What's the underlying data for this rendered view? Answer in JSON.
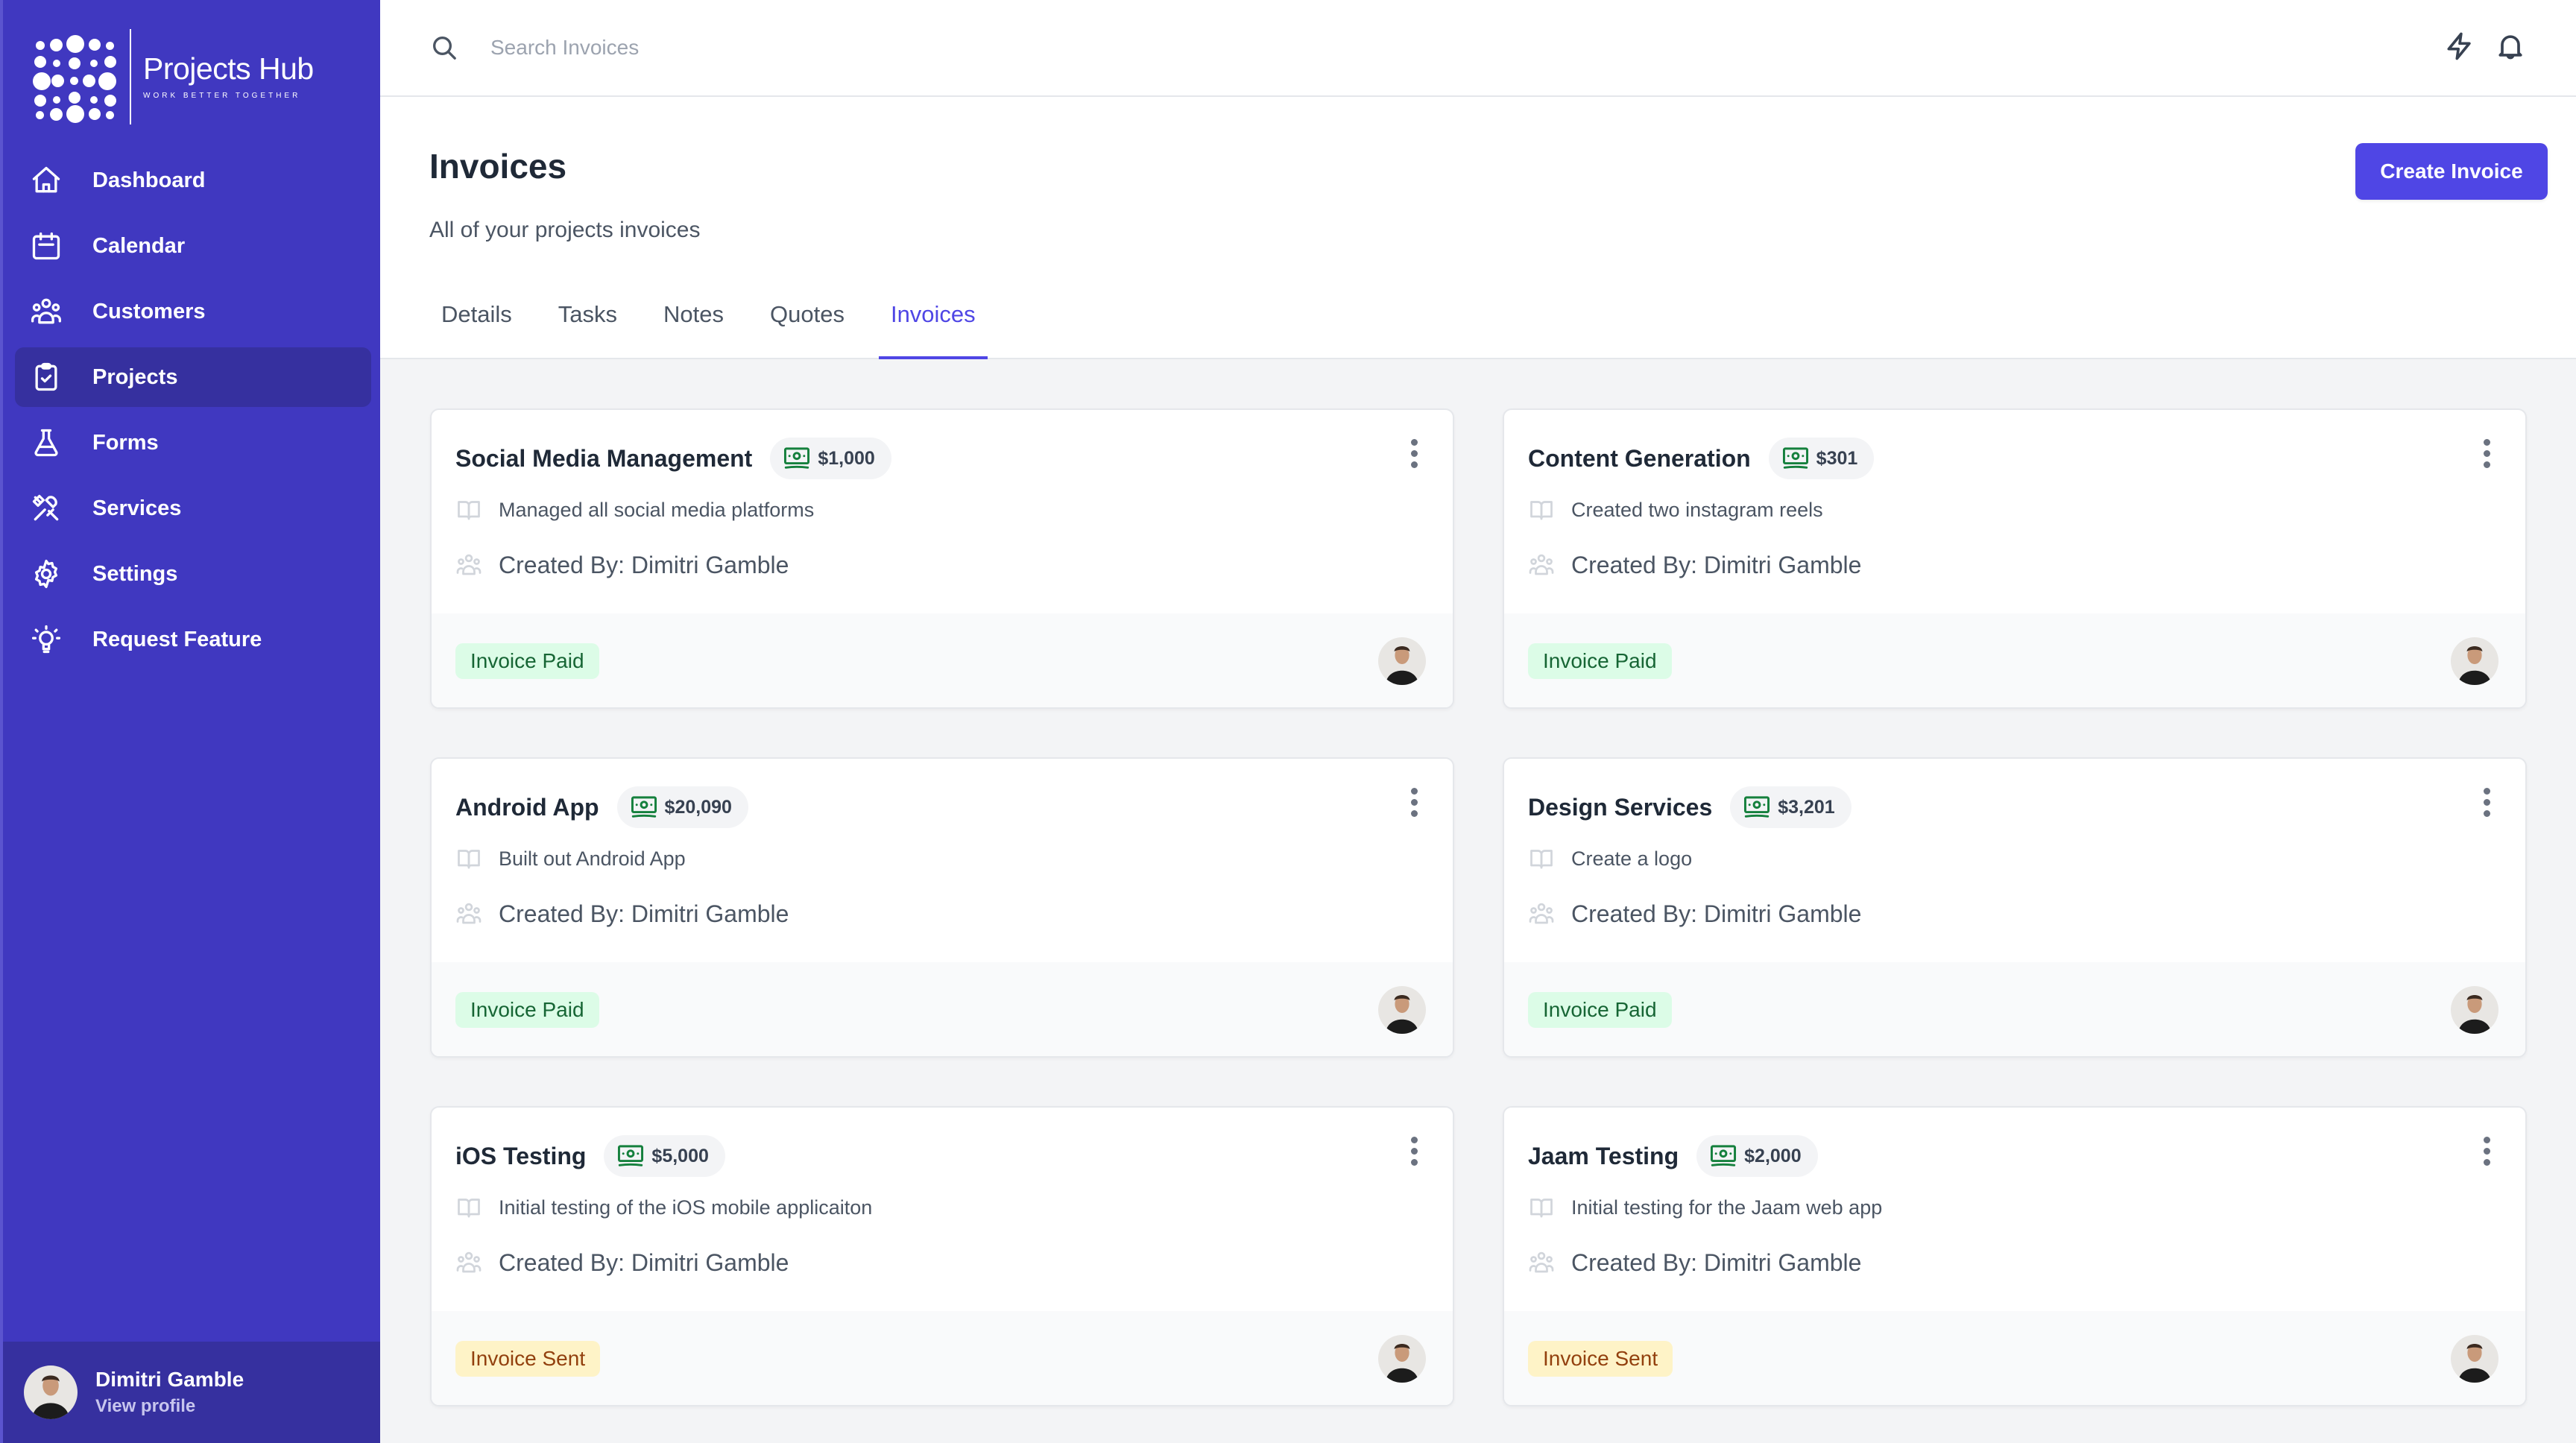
{
  "app": {
    "name": "Projects Hub",
    "tagline": "WORK BETTER TOGETHER"
  },
  "sidebar": {
    "items": [
      {
        "label": "Dashboard",
        "icon": "home-icon",
        "active": false
      },
      {
        "label": "Calendar",
        "icon": "calendar-icon",
        "active": false
      },
      {
        "label": "Customers",
        "icon": "users-icon",
        "active": false
      },
      {
        "label": "Projects",
        "icon": "clipboard-check-icon",
        "active": true
      },
      {
        "label": "Forms",
        "icon": "beaker-icon",
        "active": false
      },
      {
        "label": "Services",
        "icon": "tools-icon",
        "active": false
      },
      {
        "label": "Settings",
        "icon": "gear-icon",
        "active": false
      },
      {
        "label": "Request Feature",
        "icon": "lightbulb-icon",
        "active": false
      }
    ],
    "user": {
      "name": "Dimitri Gamble",
      "link": "View profile"
    }
  },
  "topbar": {
    "search_placeholder": "Search Invoices",
    "search_value": "",
    "icons": [
      "lightning-icon",
      "bell-icon"
    ]
  },
  "header": {
    "title": "Invoices",
    "subtitle": "All of your projects invoices",
    "create_button": "Create Invoice",
    "tabs": [
      {
        "label": "Details",
        "active": false
      },
      {
        "label": "Tasks",
        "active": false
      },
      {
        "label": "Notes",
        "active": false
      },
      {
        "label": "Quotes",
        "active": false
      },
      {
        "label": "Invoices",
        "active": true
      }
    ]
  },
  "colors": {
    "sidebar_bg": "#4038c0",
    "sidebar_active": "#36309f",
    "accent": "#4f46e5",
    "paid_bg": "#dcfce7",
    "paid_text": "#166534",
    "sent_bg": "#fef3c7",
    "sent_text": "#92400e",
    "money_icon": "#15803d"
  },
  "invoices": [
    {
      "title": "Social Media Management",
      "amount": "$1,000",
      "description": "Managed all social media platforms",
      "created_by": "Created By: Dimitri Gamble",
      "status": "Invoice Paid",
      "status_type": "paid"
    },
    {
      "title": "Content Generation",
      "amount": "$301",
      "description": "Created two instagram reels",
      "created_by": "Created By: Dimitri Gamble",
      "status": "Invoice Paid",
      "status_type": "paid"
    },
    {
      "title": "Android App",
      "amount": "$20,090",
      "description": "Built out Android App",
      "created_by": "Created By: Dimitri Gamble",
      "status": "Invoice Paid",
      "status_type": "paid"
    },
    {
      "title": "Design Services",
      "amount": "$3,201",
      "description": "Create a logo",
      "created_by": "Created By: Dimitri Gamble",
      "status": "Invoice Paid",
      "status_type": "paid"
    },
    {
      "title": "iOS Testing",
      "amount": "$5,000",
      "description": "Initial testing of the iOS mobile applicaiton",
      "created_by": "Created By: Dimitri Gamble",
      "status": "Invoice Sent",
      "status_type": "sent"
    },
    {
      "title": "Jaam Testing",
      "amount": "$2,000",
      "description": "Initial testing for the Jaam web app",
      "created_by": "Created By: Dimitri Gamble",
      "status": "Invoice Sent",
      "status_type": "sent"
    }
  ]
}
